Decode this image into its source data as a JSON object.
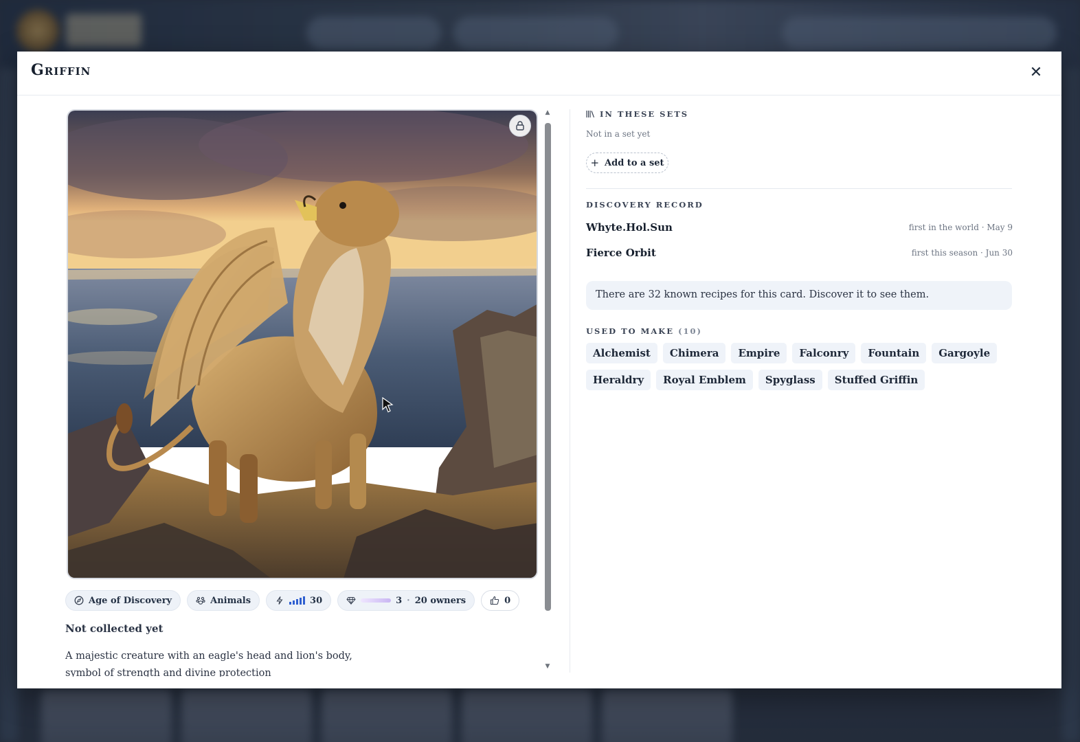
{
  "modal": {
    "title": "Griffin",
    "close_icon": "close-icon"
  },
  "card": {
    "chips": {
      "era": "Age of Discovery",
      "category": "Animals",
      "power": "30",
      "rarity_count": "3",
      "rarity_sep": "·",
      "owners": "20 owners",
      "likes": "0"
    },
    "collection_status": "Not collected yet",
    "description": "A majestic creature with an eagle's head and lion's body, symbol of strength and divine protection"
  },
  "sets": {
    "heading": "In these sets",
    "empty_text": "Not in a set yet",
    "add_button": "Add to a set"
  },
  "discovery": {
    "heading": "Discovery record",
    "entries": [
      {
        "name": "Whyte.Hol.Sun",
        "meta": "first in the world · May 9"
      },
      {
        "name": "Fierce Orbit",
        "meta": "first this season · Jun 30"
      }
    ]
  },
  "recipes": {
    "notice": "There are 32 known recipes for this card. Discover it to see them."
  },
  "used_to_make": {
    "heading": "Used to make",
    "count": "(10)",
    "items": [
      "Alchemist",
      "Chimera",
      "Empire",
      "Falconry",
      "Fountain",
      "Gargoyle",
      "Heraldry",
      "Royal Emblem",
      "Spyglass",
      "Stuffed Griffin"
    ]
  },
  "colors": {
    "accent_blue": "#2f5fd0",
    "chip_bg": "#eef2f8",
    "rarity": "#c9b6f2"
  }
}
